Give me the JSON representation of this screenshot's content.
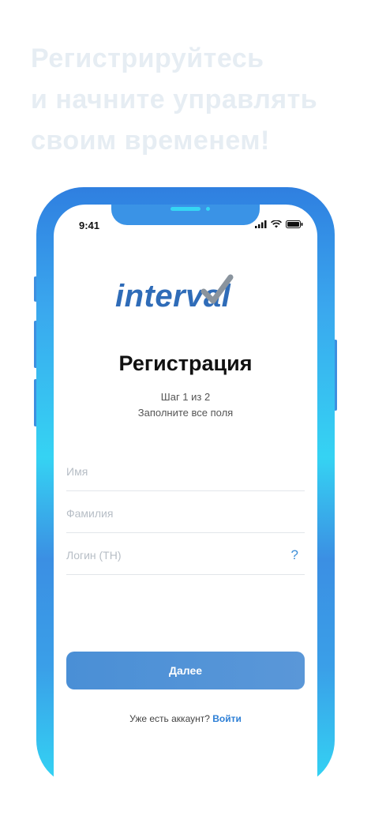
{
  "headline": {
    "lines": [
      "Регистрируйтесь",
      "и начните управлять",
      "своим временем!"
    ]
  },
  "status_bar": {
    "time": "9:41"
  },
  "app": {
    "logo_text": "interval"
  },
  "screen": {
    "title": "Регистрация",
    "step": "Шаг 1 из 2",
    "hint": "Заполните все поля",
    "fields": [
      {
        "placeholder": "Имя"
      },
      {
        "placeholder": "Фамилия"
      },
      {
        "placeholder": "Логин (ТН)",
        "help": "?"
      }
    ],
    "next_button": "Далее",
    "footer": {
      "question": "Уже есть аккаунт?",
      "login_link": "Войти"
    }
  },
  "colors": {
    "accent": "#2f6cb8",
    "button": "#4a8fd6",
    "headline": "#e6edf3"
  }
}
